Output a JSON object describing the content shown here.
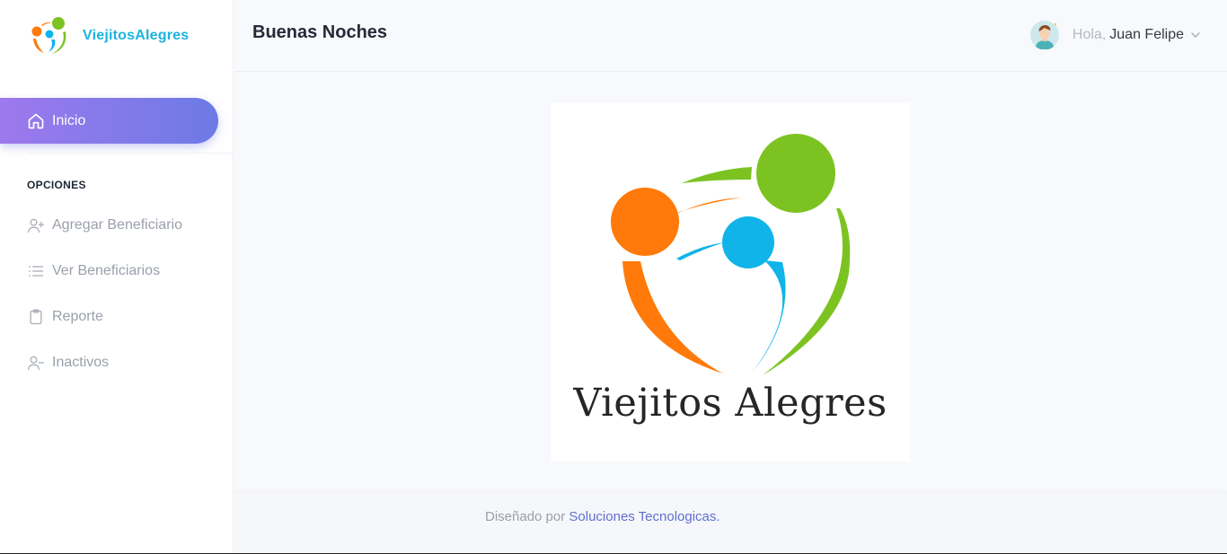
{
  "sidebar": {
    "brand": {
      "name": "ViejitosAlegres",
      "logo_icon": "viejitos-alegres-logo"
    },
    "active_item": {
      "label": "Inicio",
      "icon": "home-icon"
    },
    "section_title": "OPCIONES",
    "items": [
      {
        "label": "Agregar Beneficiario",
        "icon": "user-plus-icon"
      },
      {
        "label": "Ver Beneficiarios",
        "icon": "list-icon"
      },
      {
        "label": "Reporte",
        "icon": "clipboard-icon"
      },
      {
        "label": "Inactivos",
        "icon": "user-minus-icon"
      }
    ]
  },
  "header": {
    "title": "Buenas Noches",
    "user": {
      "greeting": "Hola,",
      "name": "Juan Felipe",
      "avatar_icon": "user-avatar",
      "dropdown_icon": "chevron-down-icon"
    }
  },
  "main": {
    "logo_caption": "Viejitos Alegres"
  },
  "footer": {
    "prefix": "Diseñado por",
    "link_text": "Soluciones Tecnologicas."
  },
  "colors": {
    "accent_gradient_start": "#9d79ed",
    "accent_gradient_end": "#6c7ae6",
    "brand_blue": "#1cb3de",
    "logo_orange": "#ff7a0a",
    "logo_green": "#7cc322",
    "logo_blue": "#10b4e8",
    "footer_link": "#5f6fce"
  }
}
